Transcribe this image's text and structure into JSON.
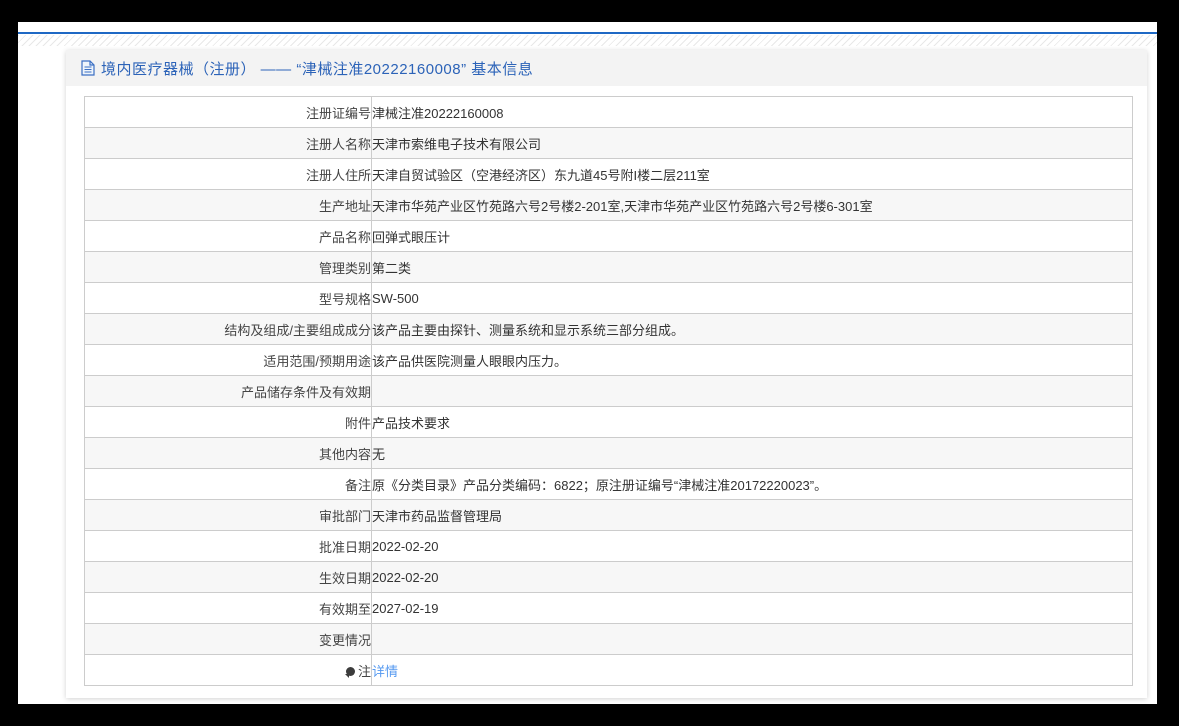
{
  "colors": {
    "accent_line_blue": "#1e68c4",
    "title_blue": "#2c63b8",
    "link_blue": "#5599f0",
    "frame_black": "#000000",
    "header_band_gray": "#f3f3f3",
    "row_alt_gray": "#f7f7f7",
    "table_border_gray": "#cccccc"
  },
  "header": {
    "icon": "document-icon",
    "title": "境内医疗器械（注册） —— “津械注准20222160008” 基本信息"
  },
  "table": {
    "rows": [
      {
        "label": "注册证编号",
        "value": "津械注准20222160008"
      },
      {
        "label": "注册人名称",
        "value": "天津市索维电子技术有限公司"
      },
      {
        "label": "注册人住所",
        "value": "天津自贸试验区（空港经济区）东九道45号附I楼二层211室"
      },
      {
        "label": "生产地址",
        "value": "天津市华苑产业区竹苑路六号2号楼2-201室,天津市华苑产业区竹苑路六号2号楼6-301室"
      },
      {
        "label": "产品名称",
        "value": "回弹式眼压计"
      },
      {
        "label": "管理类别",
        "value": "第二类"
      },
      {
        "label": "型号规格",
        "value": "SW-500"
      },
      {
        "label": "结构及组成/主要组成成分",
        "value": "该产品主要由探针、测量系统和显示系统三部分组成。"
      },
      {
        "label": "适用范围/预期用途",
        "value": "该产品供医院测量人眼眼内压力。"
      },
      {
        "label": "产品储存条件及有效期",
        "value": ""
      },
      {
        "label": "附件",
        "value": "产品技术要求"
      },
      {
        "label": "其他内容",
        "value": "无"
      },
      {
        "label": "备注",
        "value": "原《分类目录》产品分类编码：6822；原注册证编号“津械注准20172220023”。"
      },
      {
        "label": "审批部门",
        "value": "天津市药品监督管理局"
      },
      {
        "label": "批准日期",
        "value": "2022-02-20"
      },
      {
        "label": "生效日期",
        "value": "2022-02-20"
      },
      {
        "label": "有效期至",
        "value": "2027-02-19"
      },
      {
        "label": "变更情况",
        "value": ""
      },
      {
        "label": "注",
        "value": "详情",
        "value_is_link": true,
        "label_icon": "note-balloon-icon"
      }
    ]
  }
}
